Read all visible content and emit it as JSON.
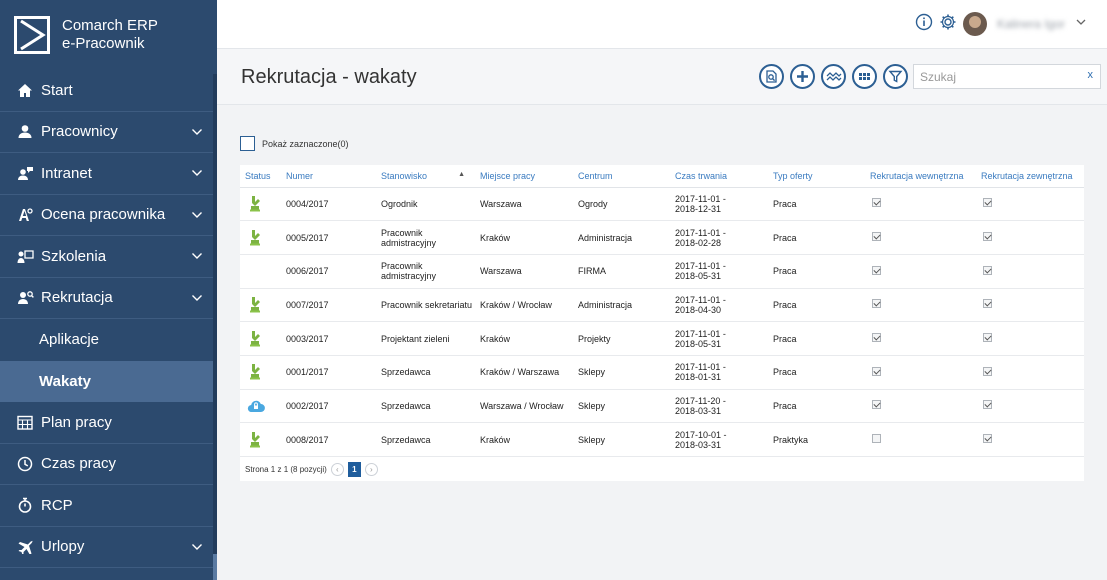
{
  "app": {
    "brand_line1": "Comarch ERP",
    "brand_line2": "e-Pracownik"
  },
  "sidebar": {
    "items": [
      {
        "label": "Start",
        "icon": "home-icon",
        "expandable": false
      },
      {
        "label": "Pracownicy",
        "icon": "user-icon",
        "expandable": true
      },
      {
        "label": "Intranet",
        "icon": "users-chat-icon",
        "expandable": true
      },
      {
        "label": "Ocena pracownika",
        "icon": "evaluation-icon",
        "expandable": true
      },
      {
        "label": "Szkolenia",
        "icon": "training-icon",
        "expandable": true
      },
      {
        "label": "Rekrutacja",
        "icon": "recruitment-icon",
        "expandable": true
      },
      {
        "label": "Aplikacje",
        "sub": true
      },
      {
        "label": "Wakaty",
        "sub": true,
        "active": true
      },
      {
        "label": "Plan pracy",
        "icon": "calendar-icon",
        "expandable": false
      },
      {
        "label": "Czas pracy",
        "icon": "clock-icon",
        "expandable": false
      },
      {
        "label": "RCP",
        "icon": "stopwatch-icon",
        "expandable": false
      },
      {
        "label": "Urlopy",
        "icon": "plane-icon",
        "expandable": true
      }
    ]
  },
  "topbar": {
    "username": "Kalinera Igor"
  },
  "header": {
    "title": "Rekrutacja - wakaty",
    "search_placeholder": "Szukaj",
    "search_clear": "x",
    "tools": [
      "search-doc-icon",
      "add-icon",
      "chart-icon",
      "grid-icon",
      "filter-icon"
    ]
  },
  "content": {
    "show_checked_label": "Pokaż zaznaczone(0)",
    "columns": [
      "Status",
      "Numer",
      "Stanowisko",
      "Miejsce pracy",
      "Centrum",
      "Czas trwania",
      "Typ oferty",
      "Rekrutacja wewnętrzna",
      "Rekrutacja zewnętrzna"
    ],
    "rows": [
      {
        "status": "published",
        "numer": "0004/2017",
        "stanowisko": "Ogrodnik",
        "miejsce": "Warszawa",
        "centrum": "Ogrody",
        "od": "2017-11-01 -",
        "do": "2018-12-31",
        "typ": "Praca",
        "wew": true,
        "zew": true
      },
      {
        "status": "published",
        "numer": "0005/2017",
        "stanowisko": "Pracownik admistracyjny",
        "miejsce": "Kraków",
        "centrum": "Administracja",
        "od": "2017-11-01 -",
        "do": "2018-02-28",
        "typ": "Praca",
        "wew": true,
        "zew": true
      },
      {
        "status": "none",
        "numer": "0006/2017",
        "stanowisko": "Pracownik admistracyjny",
        "miejsce": "Warszawa",
        "centrum": "FIRMA",
        "od": "2017-11-01 -",
        "do": "2018-05-31",
        "typ": "Praca",
        "wew": true,
        "zew": true
      },
      {
        "status": "published",
        "numer": "0007/2017",
        "stanowisko": "Pracownik sekretariatu",
        "miejsce": "Kraków / Wrocław",
        "centrum": "Administracja",
        "od": "2017-11-01 -",
        "do": "2018-04-30",
        "typ": "Praca",
        "wew": true,
        "zew": true
      },
      {
        "status": "published",
        "numer": "0003/2017",
        "stanowisko": "Projektant zieleni",
        "miejsce": "Kraków",
        "centrum": "Projekty",
        "od": "2017-11-01 -",
        "do": "2018-05-31",
        "typ": "Praca",
        "wew": true,
        "zew": true
      },
      {
        "status": "published",
        "numer": "0001/2017",
        "stanowisko": "Sprzedawca",
        "miejsce": "Kraków / Warszawa",
        "centrum": "Sklepy",
        "od": "2017-11-01 -",
        "do": "2018-01-31",
        "typ": "Praca",
        "wew": true,
        "zew": true
      },
      {
        "status": "cloud",
        "numer": "0002/2017",
        "stanowisko": "Sprzedawca",
        "miejsce": "Warszawa / Wrocław",
        "centrum": "Sklepy",
        "od": "2017-11-20 -",
        "do": "2018-03-31",
        "typ": "Praca",
        "wew": true,
        "zew": true
      },
      {
        "status": "published",
        "numer": "0008/2017",
        "stanowisko": "Sprzedawca",
        "miejsce": "Kraków",
        "centrum": "Sklepy",
        "od": "2017-10-01 -",
        "do": "2018-03-31",
        "typ": "Praktyka",
        "wew": false,
        "zew": true
      }
    ],
    "pager": {
      "info": "Strona 1 z 1 (8 pozycji)",
      "current": "1",
      "prev": "‹",
      "next": "›"
    }
  }
}
